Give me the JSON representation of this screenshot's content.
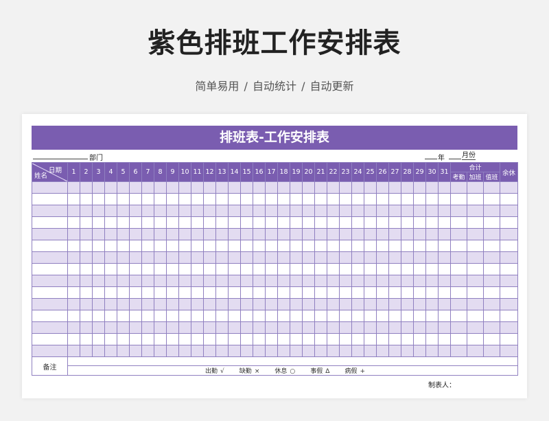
{
  "page": {
    "title": "紫色排班工作安排表",
    "subtitle": "简单易用  /  自动统计  /  自动更新"
  },
  "sheet": {
    "banner": "排班表-工作安排表",
    "dept_label": "部门",
    "year_label": "年",
    "month_label": "月份",
    "corner_top": "日期",
    "corner_bottom": "姓名",
    "days": [
      "1",
      "2",
      "3",
      "4",
      "5",
      "6",
      "7",
      "8",
      "9",
      "10",
      "11",
      "12",
      "13",
      "14",
      "15",
      "16",
      "17",
      "18",
      "19",
      "20",
      "21",
      "22",
      "23",
      "24",
      "25",
      "26",
      "27",
      "28",
      "29",
      "30",
      "31"
    ],
    "total_header": "合计",
    "total_subs": [
      "考勤",
      "加班",
      "值班"
    ],
    "rest_header": "余休",
    "row_count": 15,
    "remark_label": "备注",
    "legend": [
      {
        "label": "出勤",
        "symbol": "√"
      },
      {
        "label": "缺勤",
        "symbol": "×"
      },
      {
        "label": "休息",
        "symbol": "○"
      },
      {
        "label": "事假",
        "symbol": "Δ"
      },
      {
        "label": "病假",
        "symbol": "+"
      }
    ],
    "maker_label": "制表人：",
    "colors": {
      "header_purple": "#7a5db0",
      "row_lavender": "#e3dcf1",
      "grid_line": "#8f7fc0"
    }
  }
}
